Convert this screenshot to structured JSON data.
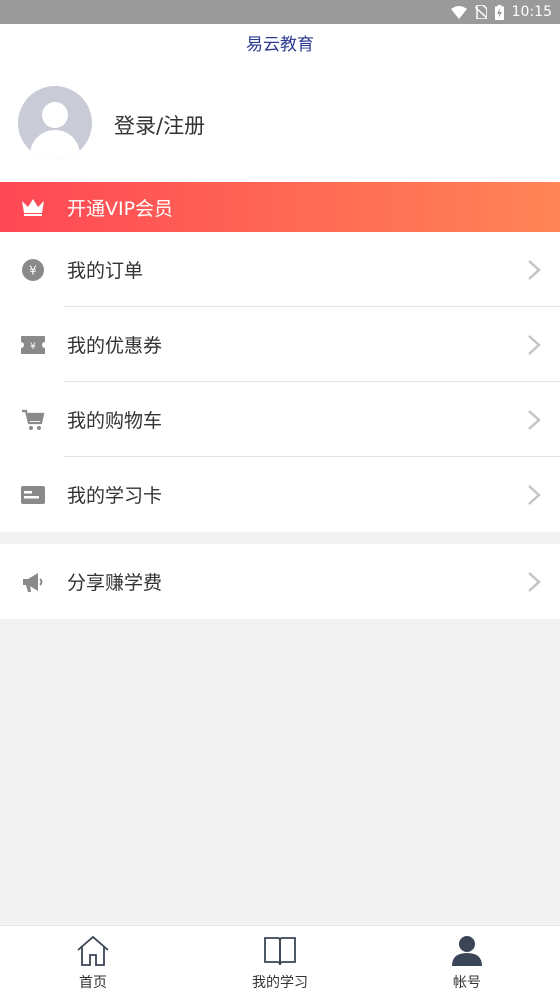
{
  "status_bar": {
    "time": "10:15",
    "icons": [
      "wifi-icon",
      "no-sim-icon",
      "battery-charging-icon"
    ]
  },
  "header": {
    "app_title": "易云教育",
    "login_label": "登录/注册",
    "avatar_icon": "default-avatar-icon"
  },
  "vip": {
    "label": "开通VIP会员",
    "icon": "crown-icon",
    "gradient": [
      "#ff4755",
      "#ff8456"
    ]
  },
  "menu": {
    "items": [
      {
        "label": "我的订单",
        "icon": "yen-coin-icon"
      },
      {
        "label": "我的优惠券",
        "icon": "coupon-ticket-icon"
      },
      {
        "label": "我的购物车",
        "icon": "shopping-cart-icon"
      },
      {
        "label": "我的学习卡",
        "icon": "study-card-icon"
      }
    ],
    "share": {
      "label": "分享赚学费",
      "icon": "megaphone-icon"
    }
  },
  "tabbar": {
    "tabs": [
      {
        "label": "首页",
        "icon": "home-icon"
      },
      {
        "label": "我的学习",
        "icon": "book-icon"
      },
      {
        "label": "帐号",
        "icon": "person-icon",
        "active": true
      }
    ]
  },
  "colors": {
    "accent": "#2b3a8f",
    "icon_gray": "#8a8a8a",
    "active_tab_icon": "#3a4655"
  }
}
